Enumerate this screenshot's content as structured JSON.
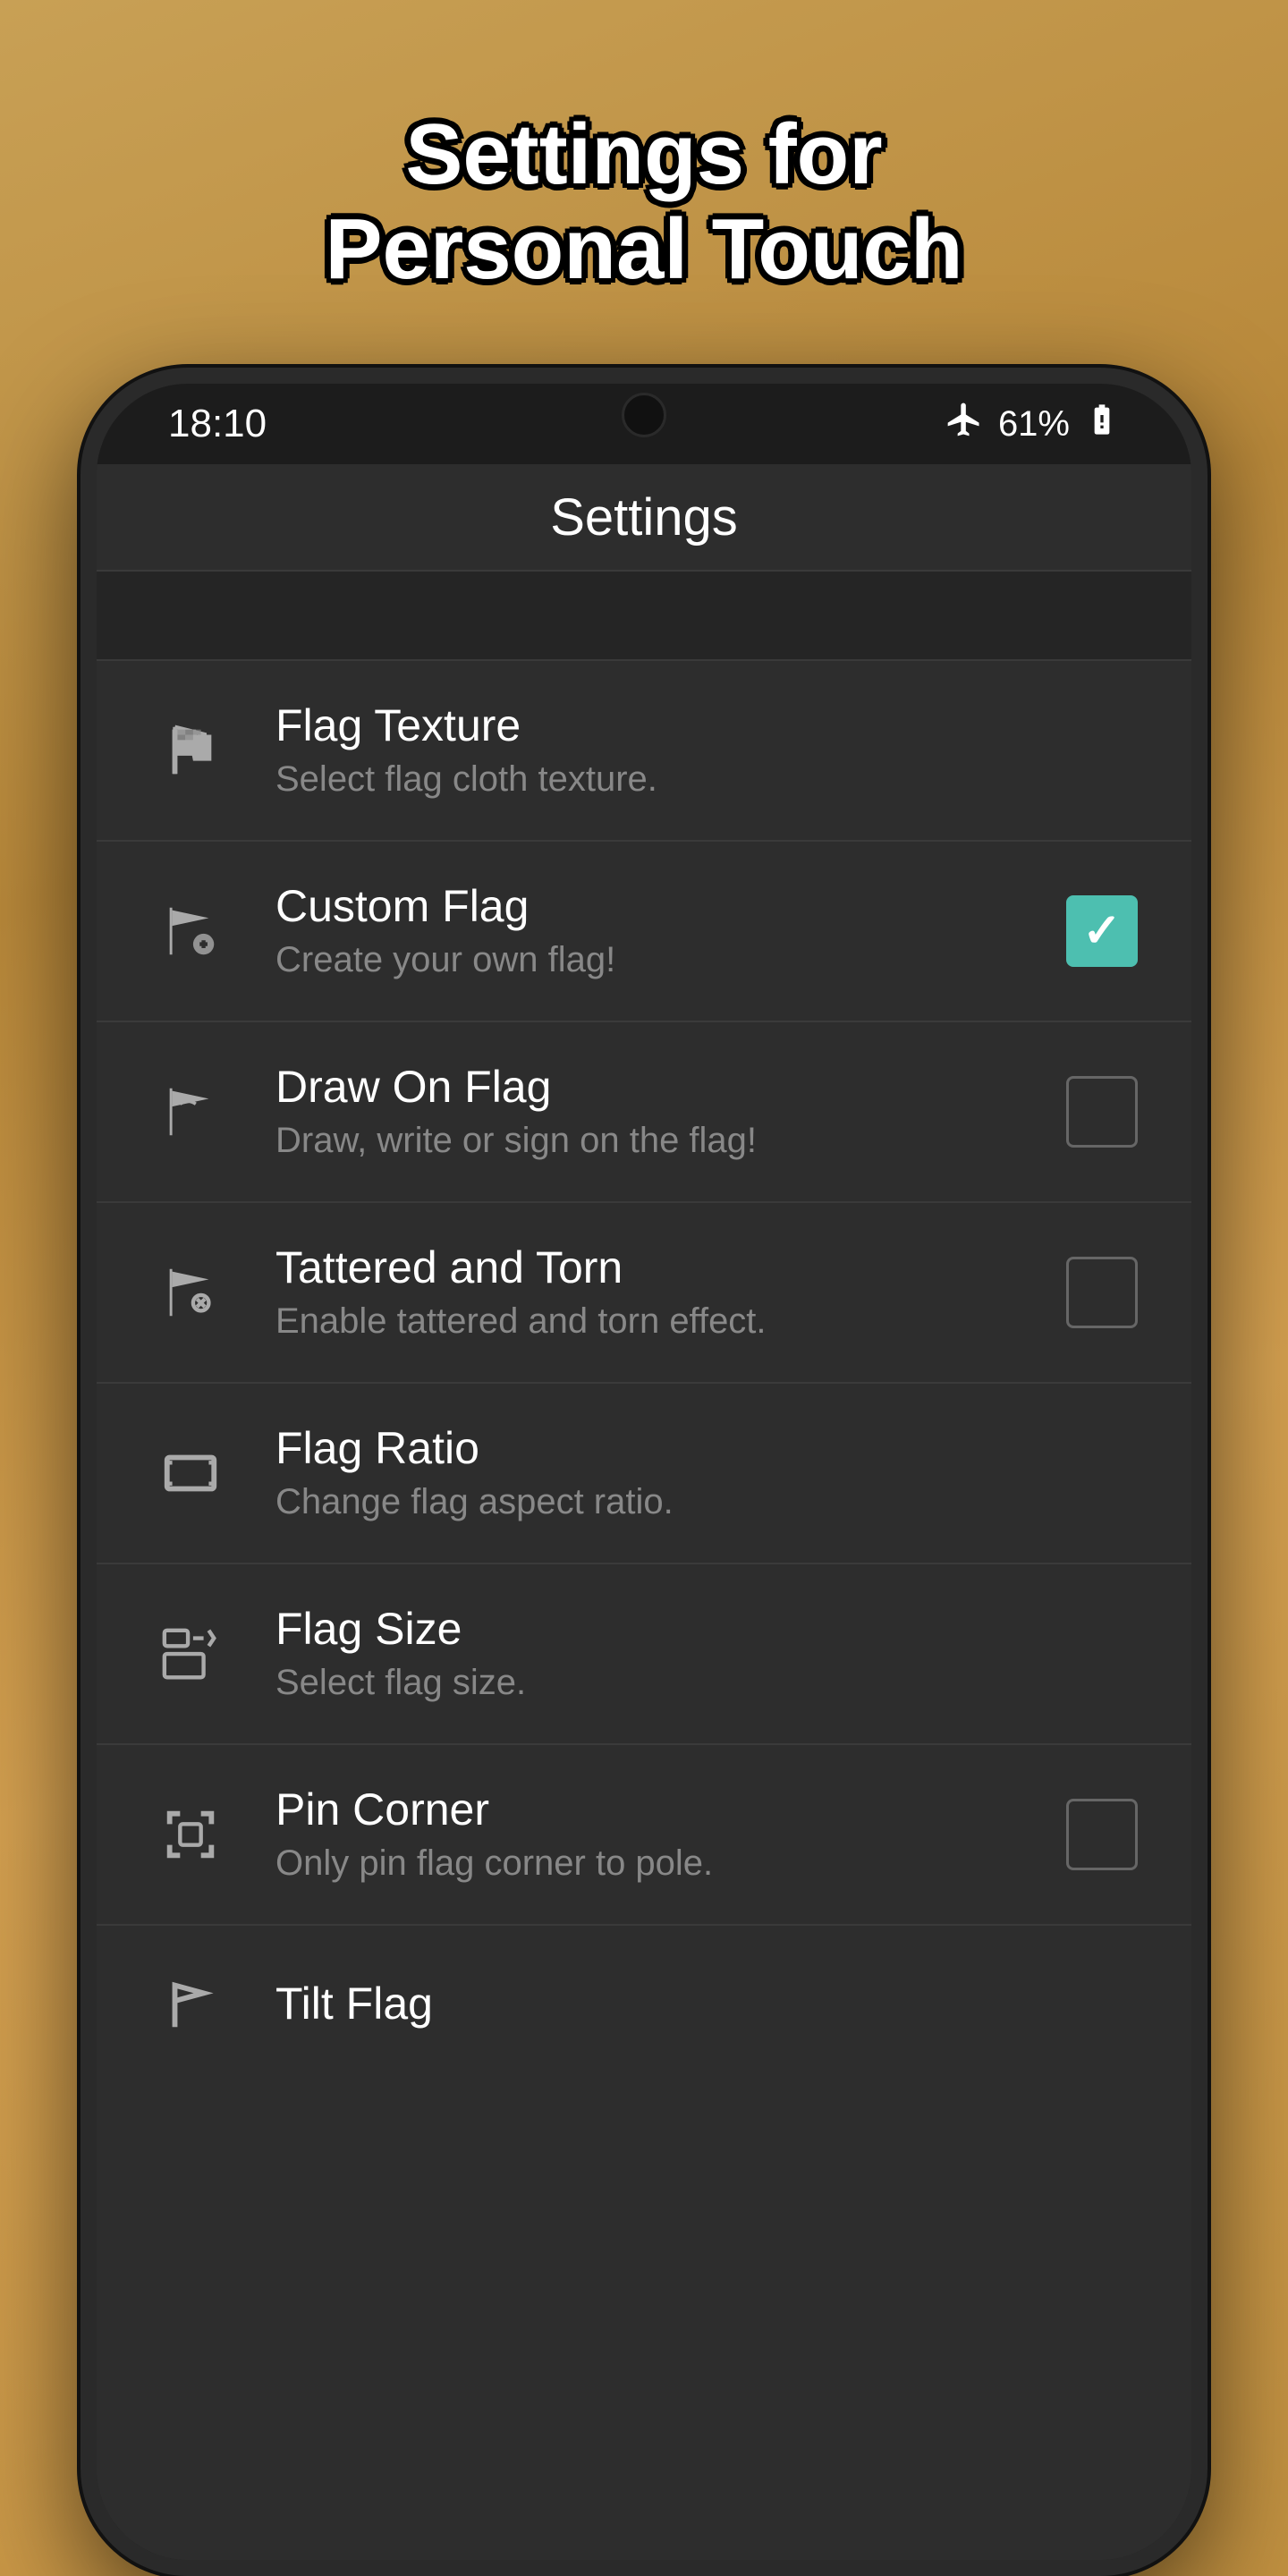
{
  "page": {
    "headline_line1": "Settings for",
    "headline_line2": "Personal Touch"
  },
  "status_bar": {
    "time": "18:10",
    "battery_percent": "61%",
    "airplane_mode": true
  },
  "app_bar": {
    "title": "Settings"
  },
  "settings": {
    "items": [
      {
        "id": "flag-texture",
        "title": "Flag Texture",
        "subtitle": "Select flag cloth texture.",
        "has_checkbox": false,
        "checked": false,
        "icon": "flag-texture-icon"
      },
      {
        "id": "custom-flag",
        "title": "Custom Flag",
        "subtitle": "Create your own flag!",
        "has_checkbox": true,
        "checked": true,
        "icon": "custom-flag-icon"
      },
      {
        "id": "draw-on-flag",
        "title": "Draw On Flag",
        "subtitle": "Draw, write or sign on the flag!",
        "has_checkbox": true,
        "checked": false,
        "icon": "draw-flag-icon"
      },
      {
        "id": "tattered-and-torn",
        "title": "Tattered and Torn",
        "subtitle": "Enable tattered and torn effect.",
        "has_checkbox": true,
        "checked": false,
        "icon": "tattered-flag-icon"
      },
      {
        "id": "flag-ratio",
        "title": "Flag Ratio",
        "subtitle": "Change flag aspect ratio.",
        "has_checkbox": false,
        "checked": false,
        "icon": "flag-ratio-icon"
      },
      {
        "id": "flag-size",
        "title": "Flag Size",
        "subtitle": "Select flag size.",
        "has_checkbox": false,
        "checked": false,
        "icon": "flag-size-icon"
      },
      {
        "id": "pin-corner",
        "title": "Pin Corner",
        "subtitle": "Only pin flag corner to pole.",
        "has_checkbox": true,
        "checked": false,
        "icon": "pin-corner-icon"
      },
      {
        "id": "tilt-flag",
        "title": "Tilt Flag",
        "subtitle": "",
        "has_checkbox": false,
        "checked": false,
        "icon": "tilt-flag-icon",
        "partial": true
      }
    ]
  }
}
